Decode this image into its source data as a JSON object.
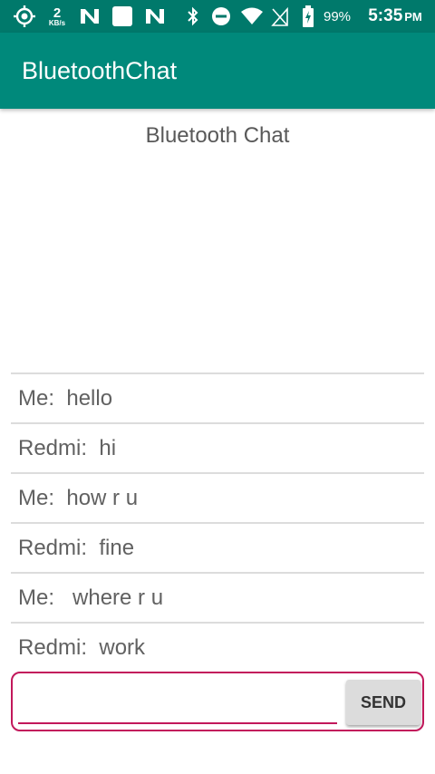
{
  "status_bar": {
    "network_speed": "2",
    "network_speed_unit": "KB/s",
    "battery_percent": "99%",
    "time": "5:35",
    "time_period": "PM",
    "icons": [
      "location-target-icon",
      "n-notification-icon",
      "blank-notification-icon",
      "n-notification-icon",
      "bluetooth-icon",
      "do-not-disturb-icon",
      "wifi-icon",
      "no-sim-icon",
      "battery-charging-icon"
    ]
  },
  "app_bar": {
    "title": "BluetoothChat"
  },
  "content": {
    "title": "Bluetooth Chat"
  },
  "messages": [
    {
      "text": "Me:  hello"
    },
    {
      "text": "Redmi:  hi"
    },
    {
      "text": "Me:  how r u"
    },
    {
      "text": "Redmi:  fine"
    },
    {
      "text": "Me:   where r u"
    },
    {
      "text": "Redmi:  work"
    }
  ],
  "composer": {
    "input_value": "",
    "send_label": "SEND"
  },
  "colors": {
    "status_bar": "#00796b",
    "app_bar": "#00897b",
    "accent": "#c2185b"
  }
}
